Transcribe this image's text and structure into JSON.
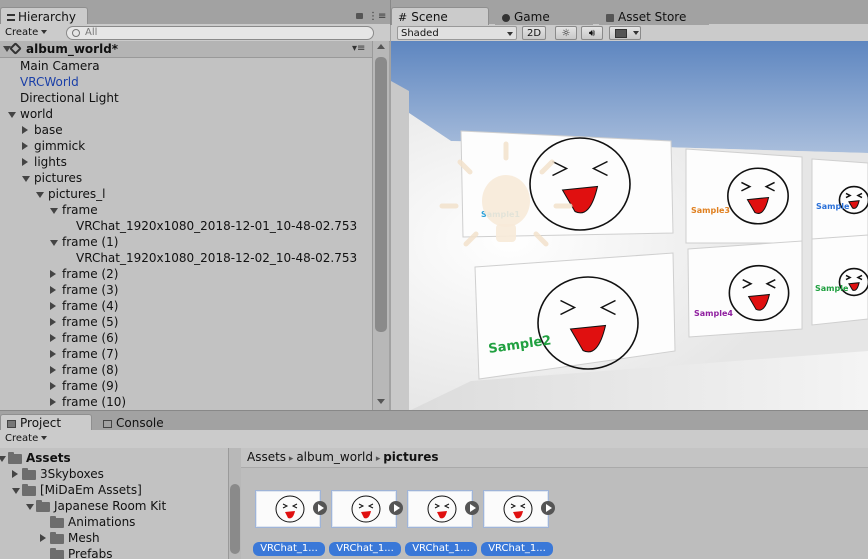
{
  "hierarchy": {
    "tab_label": "Hierarchy",
    "create_label": "Create",
    "search_placeholder": "All",
    "scene_name": "album_world*",
    "items": [
      {
        "label": "Main Camera",
        "depth": 0,
        "arrow": "none",
        "blue": false
      },
      {
        "label": "VRCWorld",
        "depth": 0,
        "arrow": "none",
        "blue": true
      },
      {
        "label": "Directional Light",
        "depth": 0,
        "arrow": "none",
        "blue": false
      },
      {
        "label": "world",
        "depth": 0,
        "arrow": "down",
        "blue": false
      },
      {
        "label": "base",
        "depth": 1,
        "arrow": "right",
        "blue": false
      },
      {
        "label": "gimmick",
        "depth": 1,
        "arrow": "right",
        "blue": false
      },
      {
        "label": "lights",
        "depth": 1,
        "arrow": "right",
        "blue": false
      },
      {
        "label": "pictures",
        "depth": 1,
        "arrow": "down",
        "blue": false
      },
      {
        "label": "pictures_l",
        "depth": 2,
        "arrow": "down",
        "blue": false
      },
      {
        "label": "frame",
        "depth": 3,
        "arrow": "down",
        "blue": false
      },
      {
        "label": "VRChat_1920x1080_2018-12-01_10-48-02.753",
        "depth": 4,
        "arrow": "none",
        "blue": false
      },
      {
        "label": "frame (1)",
        "depth": 3,
        "arrow": "down",
        "blue": false
      },
      {
        "label": "VRChat_1920x1080_2018-12-02_10-48-02.753",
        "depth": 4,
        "arrow": "none",
        "blue": false
      },
      {
        "label": "frame (2)",
        "depth": 3,
        "arrow": "right",
        "blue": false
      },
      {
        "label": "frame (3)",
        "depth": 3,
        "arrow": "right",
        "blue": false
      },
      {
        "label": "frame (4)",
        "depth": 3,
        "arrow": "right",
        "blue": false
      },
      {
        "label": "frame (5)",
        "depth": 3,
        "arrow": "right",
        "blue": false
      },
      {
        "label": "frame (6)",
        "depth": 3,
        "arrow": "right",
        "blue": false
      },
      {
        "label": "frame (7)",
        "depth": 3,
        "arrow": "right",
        "blue": false
      },
      {
        "label": "frame (8)",
        "depth": 3,
        "arrow": "right",
        "blue": false
      },
      {
        "label": "frame (9)",
        "depth": 3,
        "arrow": "right",
        "blue": false
      },
      {
        "label": "frame (10)",
        "depth": 3,
        "arrow": "right",
        "blue": false
      }
    ]
  },
  "scene": {
    "tabs": [
      {
        "label": "Scene",
        "icon": "hash-icon",
        "active": true
      },
      {
        "label": "Game",
        "icon": "pacman-icon",
        "active": false
      },
      {
        "label": "Asset Store",
        "icon": "bag-icon",
        "active": false
      }
    ],
    "shading_mode": "Shaded",
    "mode_2d_label": "2D",
    "pictures": [
      {
        "caption": "Sample1",
        "caption_color": "#2aa0d8"
      },
      {
        "caption": "Sample3",
        "caption_color": "#e08020"
      },
      {
        "caption": "Sample",
        "caption_color": "#2a70d8"
      },
      {
        "caption": "Sample2",
        "caption_color": "#20a040"
      },
      {
        "caption": "Sample4",
        "caption_color": "#9020a0"
      },
      {
        "caption": "Sample",
        "caption_color": "#20a040"
      }
    ]
  },
  "project": {
    "tabs": [
      {
        "label": "Project",
        "icon": "folder-icon",
        "active": true
      },
      {
        "label": "Console",
        "icon": "console-icon",
        "active": false
      }
    ],
    "create_label": "Create",
    "tree": [
      {
        "label": "Assets",
        "depth": 0,
        "arrow": "down",
        "bold": true
      },
      {
        "label": "3Skyboxes",
        "depth": 1,
        "arrow": "right",
        "bold": false
      },
      {
        "label": "[MiDaEm Assets]",
        "depth": 1,
        "arrow": "down",
        "bold": false
      },
      {
        "label": "Japanese Room Kit",
        "depth": 2,
        "arrow": "down",
        "bold": false
      },
      {
        "label": "Animations",
        "depth": 3,
        "arrow": "none",
        "bold": false
      },
      {
        "label": "Mesh",
        "depth": 3,
        "arrow": "right",
        "bold": false
      },
      {
        "label": "Prefabs",
        "depth": 3,
        "arrow": "none",
        "bold": false
      }
    ],
    "breadcrumb": [
      "Assets",
      "album_world",
      "pictures"
    ],
    "assets": [
      {
        "label": "VRChat_1..."
      },
      {
        "label": "VRChat_1..."
      },
      {
        "label": "VRChat_1..."
      },
      {
        "label": "VRChat_1..."
      }
    ]
  }
}
